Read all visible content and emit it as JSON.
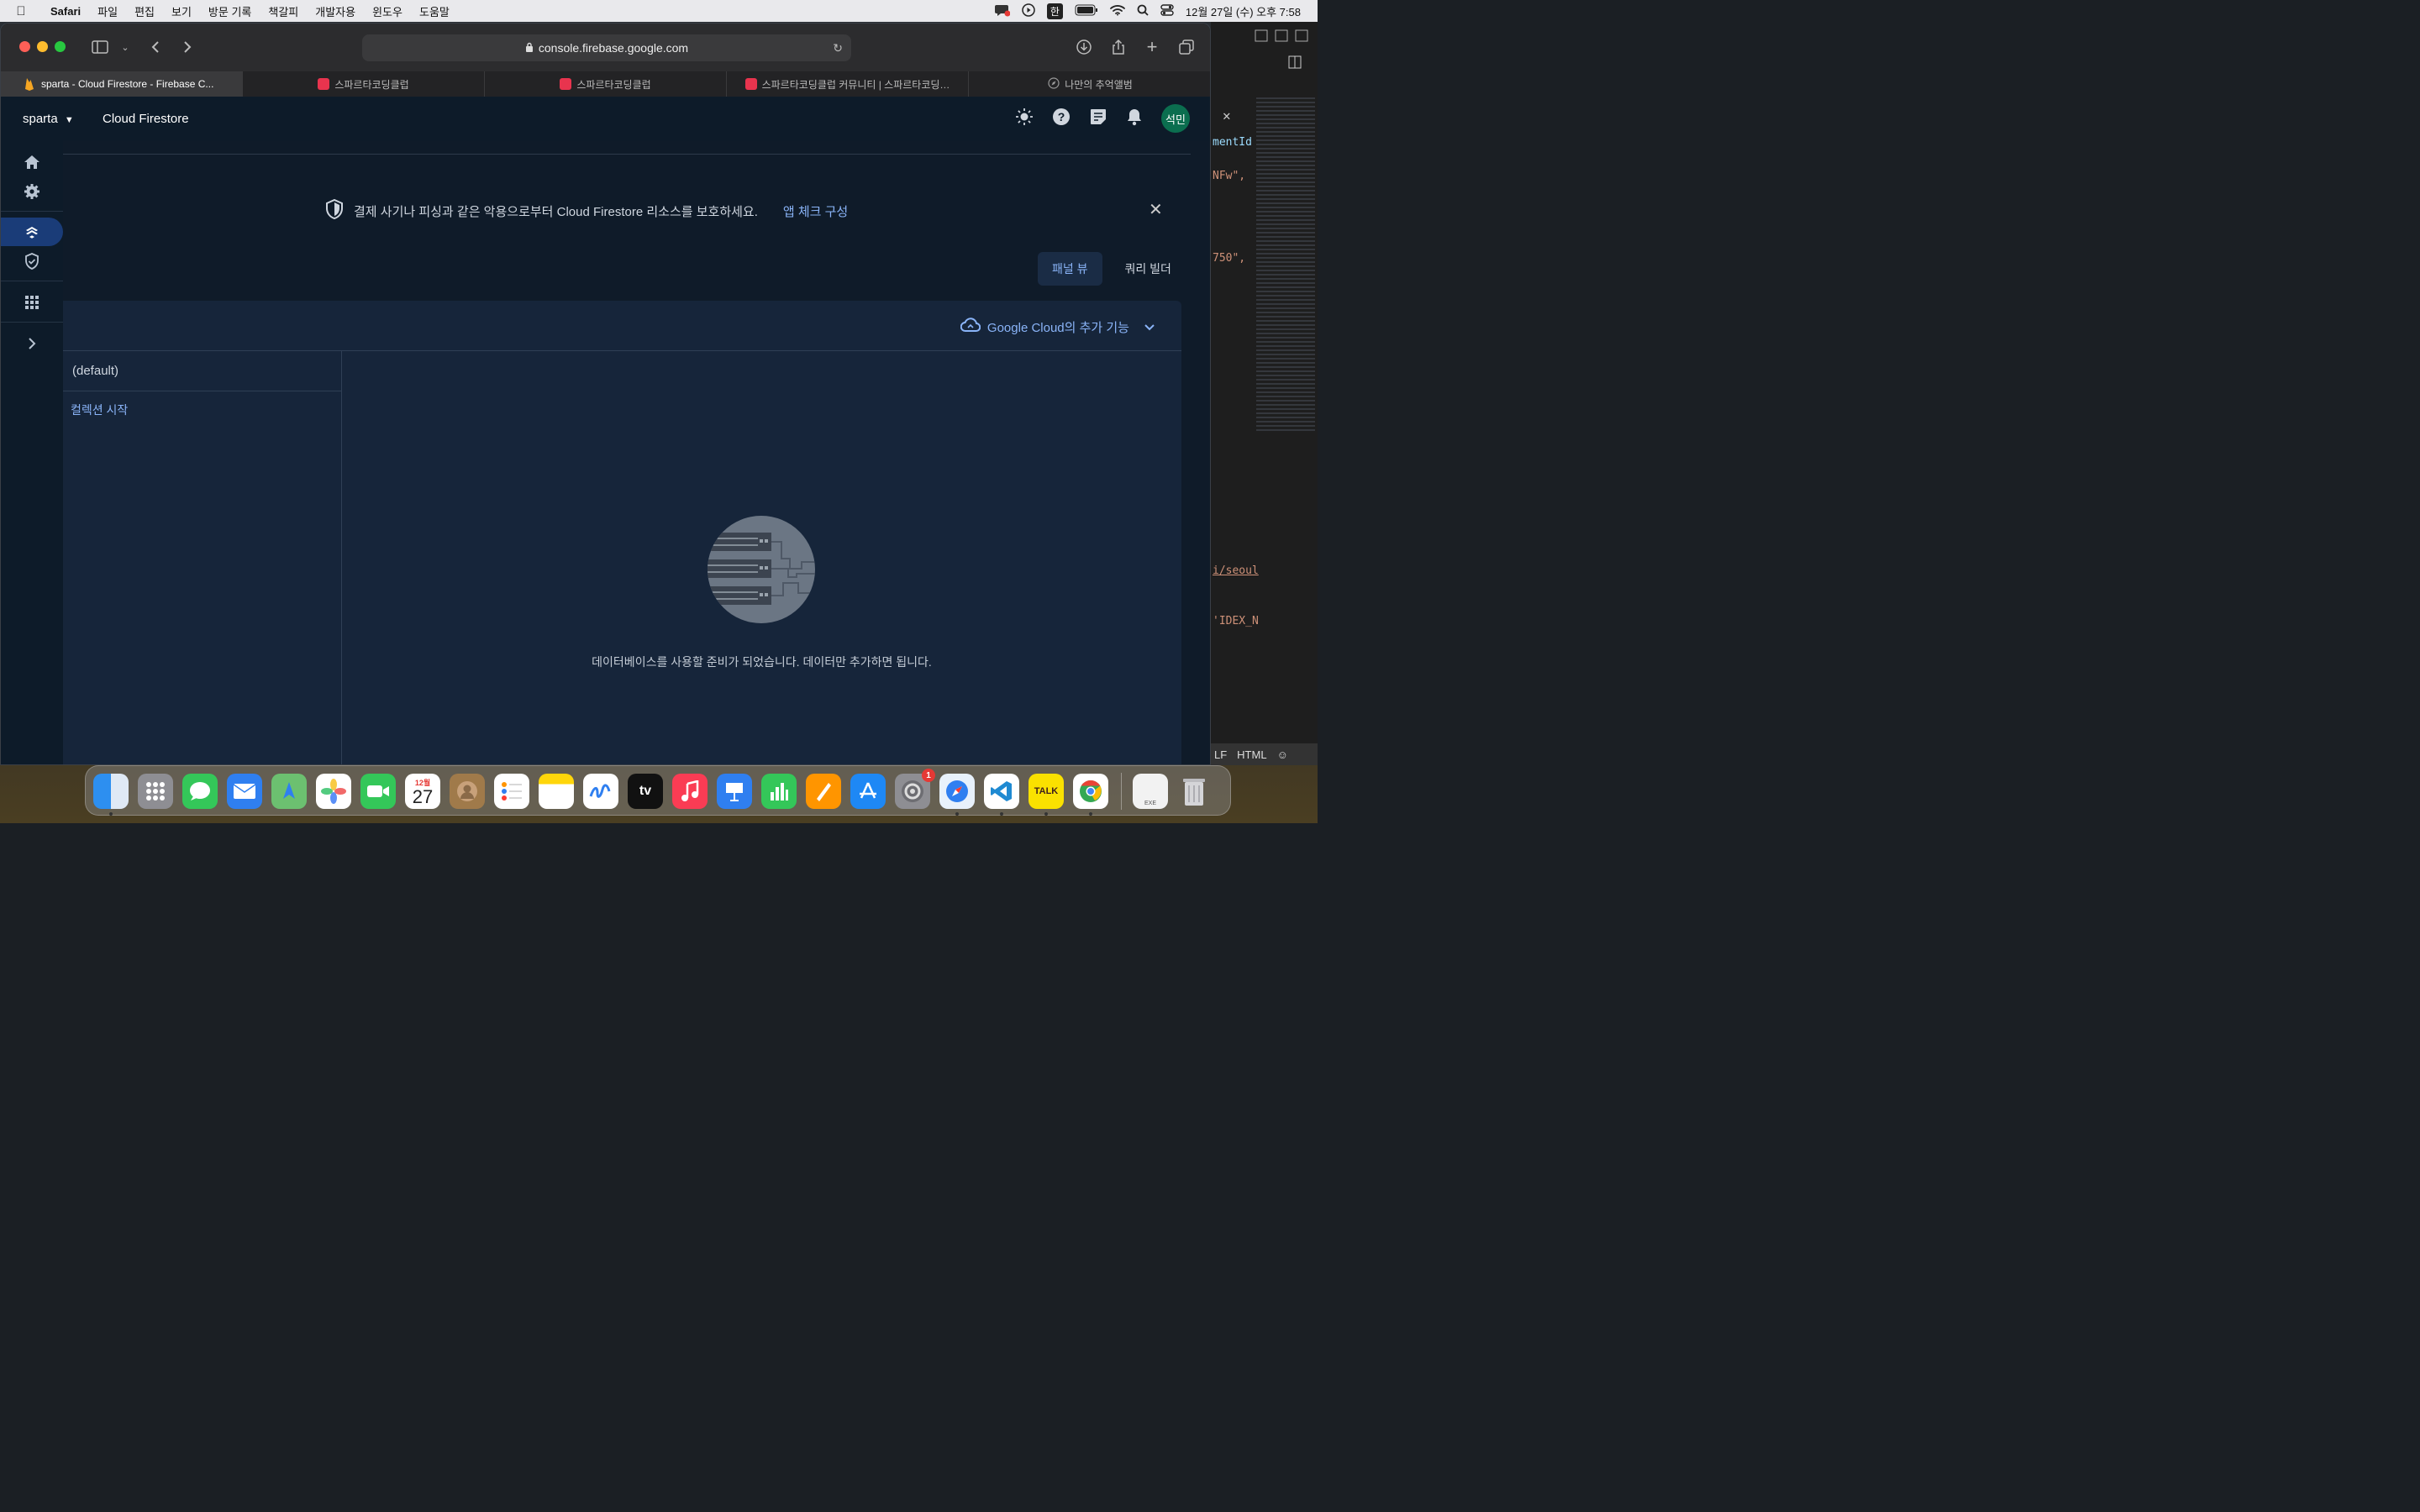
{
  "menubar": {
    "app": "Safari",
    "items": [
      "파일",
      "편집",
      "보기",
      "방문 기록",
      "책갈피",
      "개발자용",
      "윈도우",
      "도움말"
    ],
    "input_mode": "한",
    "clock": "12월 27일 (수) 오후 7:58"
  },
  "browser": {
    "url": "console.firebase.google.com",
    "tabs": [
      {
        "label": "sparta - Cloud Firestore - Firebase C...",
        "active": true,
        "color": "#f6a623"
      },
      {
        "label": "스파르타코딩클럽",
        "active": false,
        "color": "#e8344e"
      },
      {
        "label": "스파르타코딩클럽",
        "active": false,
        "color": "#e8344e"
      },
      {
        "label": "스파르타코딩클럽 커뮤니티 | 스파르타코딩…",
        "active": false,
        "color": "#e8344e"
      },
      {
        "label": "나만의 추억앨범",
        "active": false,
        "color": "#888888"
      }
    ]
  },
  "header": {
    "project": "sparta",
    "product": "Cloud Firestore",
    "avatar": "석민"
  },
  "banner": {
    "text": "결제 사기나 피싱과 같은 악용으로부터 Cloud Firestore 리소스를 보호하세요.",
    "link": "앱 체크 구성"
  },
  "view_toggle": {
    "panel_view": "패널 뷰",
    "query_builder": "쿼리 빌더"
  },
  "panel": {
    "google_cloud_label": "Google Cloud의 추가 기능",
    "database": "(default)",
    "start_collection": "컬렉션 시작",
    "empty_message": "데이터베이스를 사용할 준비가 되었습니다. 데이터만 추가하면 됩니다."
  },
  "editor": {
    "fragments": [
      "mentId",
      "NFw\",",
      "750\",",
      "i/seoul",
      "'IDEX_N"
    ],
    "status": {
      "eol": "LF",
      "language": "HTML"
    }
  },
  "dock": {
    "calendar": {
      "month": "12월",
      "day": "27"
    },
    "tv_label": "tv",
    "talk_label": "TALK",
    "settings_badge": "1",
    "exe_label": "EXE"
  },
  "colors": {
    "accent": "#8ab4f8",
    "avatar": "#0b6e4f",
    "active_nav": "#1a3c78"
  }
}
